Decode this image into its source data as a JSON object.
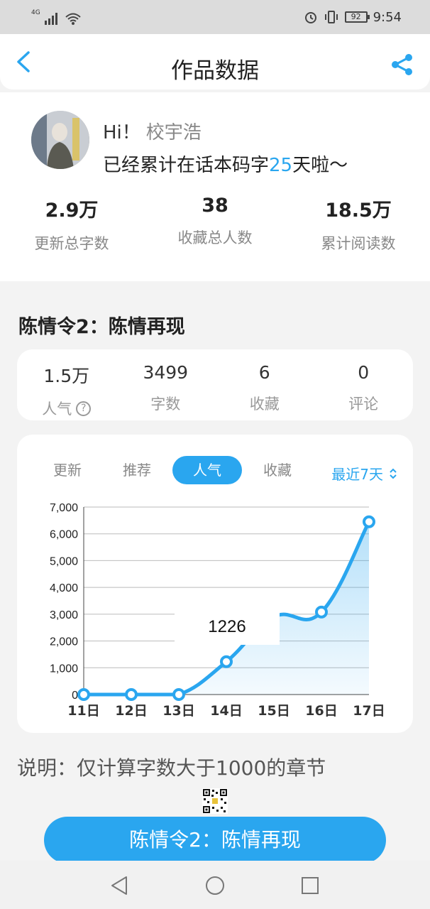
{
  "status_bar": {
    "network": "4G",
    "battery": "92",
    "time": "9:54"
  },
  "header": {
    "title": "作品数据"
  },
  "profile": {
    "greeting": "Hi！",
    "username": "校宇浩",
    "days_prefix": "已经累计在话本码字",
    "days_count": "25",
    "days_suffix": "天啦～",
    "stats": [
      {
        "value": "2.9万",
        "label": "更新总字数"
      },
      {
        "value": "38",
        "label": "收藏总人数"
      },
      {
        "value": "18.5万",
        "label": "累计阅读数"
      }
    ]
  },
  "work": {
    "title": "陈情令2：陈情再现",
    "stats": [
      {
        "value": "1.5万",
        "label": "人气"
      },
      {
        "value": "3499",
        "label": "字数"
      },
      {
        "value": "6",
        "label": "收藏"
      },
      {
        "value": "0",
        "label": "评论"
      }
    ]
  },
  "chart_tabs": {
    "tabs": [
      "更新",
      "推荐",
      "人气",
      "收藏"
    ],
    "active": "人气",
    "range": "最近7天"
  },
  "chart_data": {
    "type": "area",
    "x": [
      "11日",
      "12日",
      "13日",
      "14日",
      "15日",
      "16日",
      "17日"
    ],
    "series": [
      {
        "values": [
          0,
          0,
          0,
          1226,
          2900,
          3080,
          6450
        ]
      }
    ],
    "ylim": [
      0,
      7000
    ],
    "yticks": [
      "0",
      "1,000",
      "2,000",
      "3,000",
      "4,000",
      "5,000",
      "6,000",
      "7,000"
    ],
    "tooltip_value": "1226",
    "grid": true,
    "color": "#2aa6ef"
  },
  "footer": {
    "note": "说明：仅计算字数大于1000的章节",
    "button_label": "陈情令2：陈情再现"
  }
}
